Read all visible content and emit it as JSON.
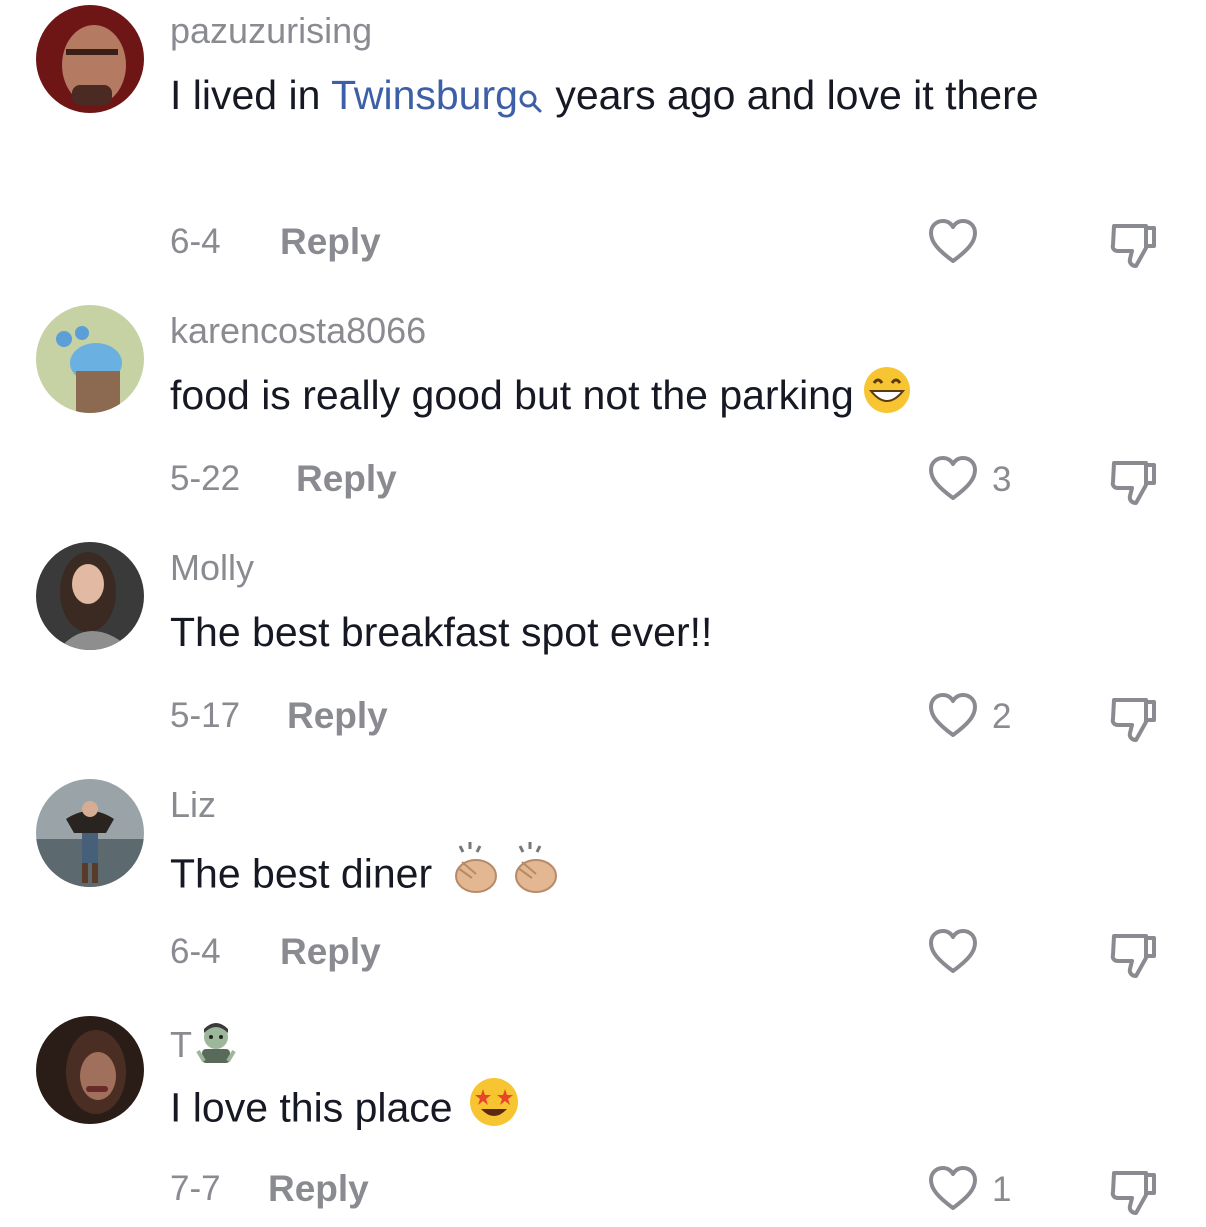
{
  "comments": [
    {
      "username": "pazuzurising",
      "text_before": "I lived in ",
      "link_text": "Twinsburg",
      "text_after": " years ago and love it there",
      "date": "6-4",
      "reply_label": "Reply",
      "like_count": ""
    },
    {
      "username": "karencosta8066",
      "text": "food is really good but not the parking",
      "emoji": "grinning-face",
      "date": "5-22",
      "reply_label": "Reply",
      "like_count": "3"
    },
    {
      "username": "Molly",
      "text": "The best breakfast spot ever!!",
      "date": "5-17",
      "reply_label": "Reply",
      "like_count": "2"
    },
    {
      "username": "Liz",
      "text": "The best diner",
      "emoji": "clapping-hands x2",
      "date": "6-4",
      "reply_label": "Reply",
      "like_count": ""
    },
    {
      "username": "T",
      "username_emoji": "zombie",
      "text": "I love this place",
      "emoji": "star-struck",
      "date": "7-7",
      "reply_label": "Reply",
      "like_count": "1"
    }
  ],
  "colors": {
    "username": "#8a8b91",
    "text": "#161823",
    "link": "#3d5fa8",
    "icon": "#8a8b91"
  }
}
